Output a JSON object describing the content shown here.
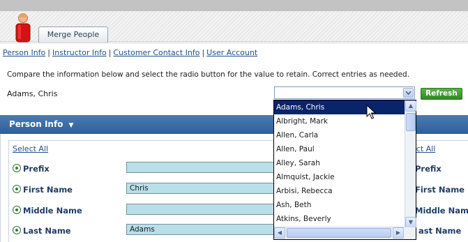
{
  "header": {
    "tab_label": "Merge People"
  },
  "nav": {
    "links": [
      "Person Info",
      "Instructor Info",
      "Customer Contact Info",
      "User Account"
    ],
    "separator": "|"
  },
  "instruction": "Compare the information below and select the radio button for the value to retain. Correct entries as needed.",
  "current_person": "Adams, Chris",
  "dropdown": {
    "selected_value": "",
    "options": [
      "Adams, Chris",
      "Albright, Mark",
      "Allen, Carla",
      "Allen, Paul",
      "Alley, Sarah",
      "Almquist, Jackie",
      "Arbisi, Rebecca",
      "Ash, Beth",
      "Atkins, Beverly"
    ],
    "highlighted_index": 0
  },
  "refresh_label": "Refresh",
  "section": {
    "title": "Person Info",
    "select_all_left": "Select All",
    "select_all_right": "ect All",
    "fields": [
      {
        "label": "Prefix",
        "value": "",
        "right_label": "Prefix"
      },
      {
        "label": "First Name",
        "value": "Chris",
        "right_label": "First Name"
      },
      {
        "label": "Middle Name",
        "value": "",
        "right_label": "Middle Name"
      },
      {
        "label": "Last Name",
        "value": "Adams",
        "right_label": "ast Name"
      }
    ]
  },
  "colors": {
    "section_bar": "#3b6ca6",
    "link": "#1f4e8c",
    "input_bg": "#b9dfe9",
    "highlight": "#0a246a",
    "refresh": "#3e9a2f"
  },
  "icons": {
    "avatar": "person-icon",
    "caret": "chevron-down-icon",
    "radio": "radio-selected-icon"
  }
}
